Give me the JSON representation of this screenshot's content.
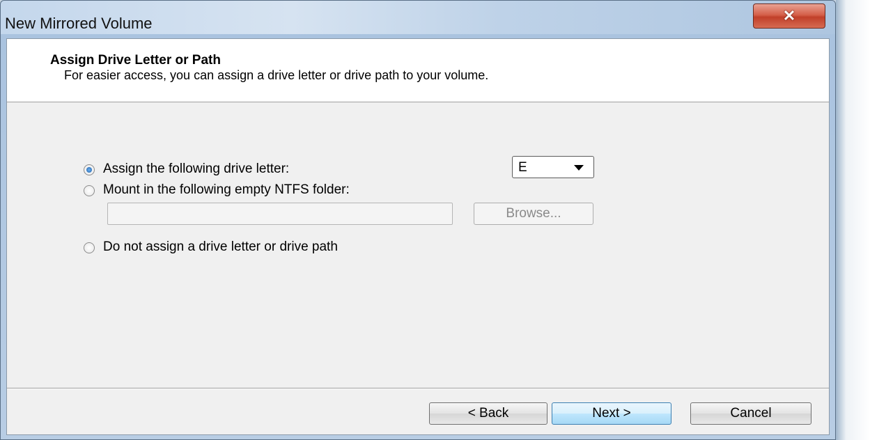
{
  "window": {
    "title": "New Mirrored Volume",
    "close_label": "✕"
  },
  "header": {
    "title": "Assign Drive Letter or Path",
    "subtitle": "For easier access, you can assign a drive letter or drive path to your volume."
  },
  "options": {
    "assign_letter": {
      "label": "Assign the following drive letter:",
      "checked": true
    },
    "mount_folder": {
      "label": "Mount in the following empty NTFS folder:",
      "checked": false
    },
    "no_assign": {
      "label": "Do not assign a drive letter or drive path",
      "checked": false
    }
  },
  "drive_letter": {
    "value": "E"
  },
  "folder_path": {
    "value": ""
  },
  "buttons": {
    "browse": "Browse...",
    "back": "< Back",
    "next": "Next >",
    "cancel": "Cancel"
  },
  "colors": {
    "close_button": "#c1402a",
    "default_button_border": "#3c7fb1",
    "radio_selected": "#1e5fa8"
  }
}
